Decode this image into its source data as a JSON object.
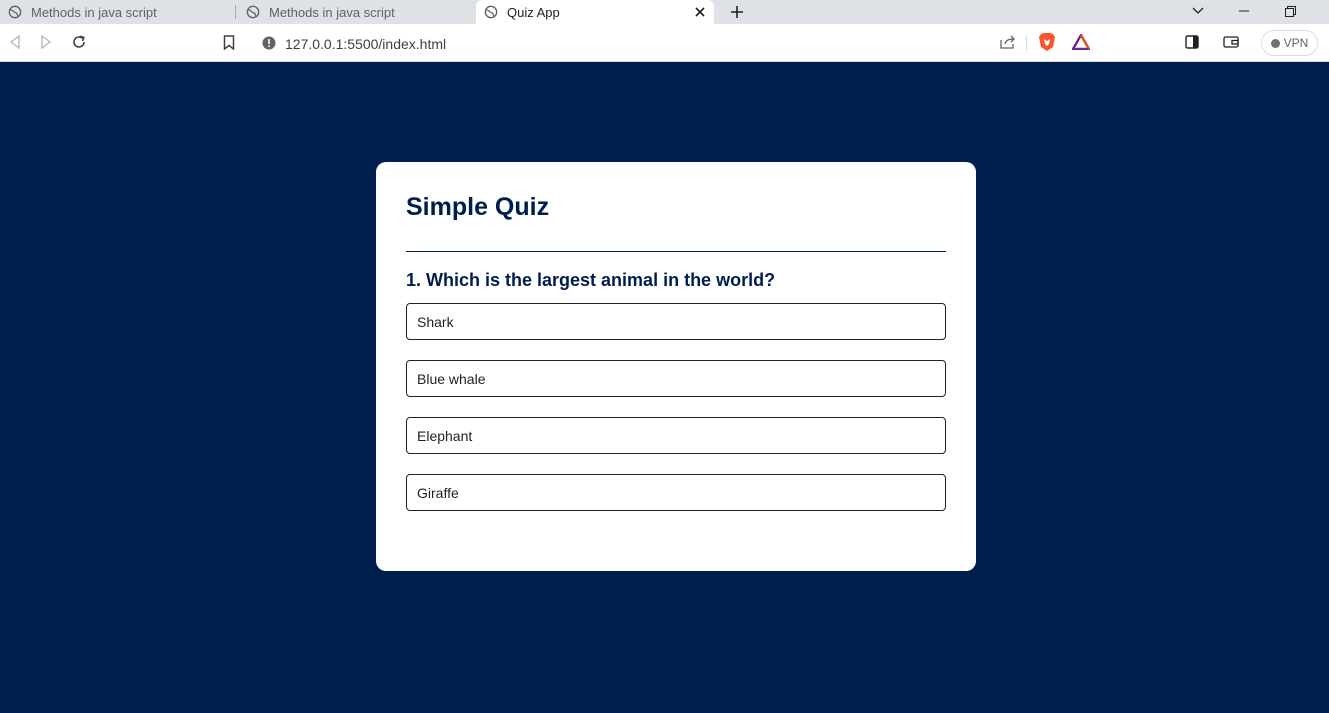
{
  "browser": {
    "tabs": [
      {
        "title": "Methods in java script",
        "icon": "globe-icon",
        "active": false
      },
      {
        "title": "Methods in java script",
        "icon": "globe-icon",
        "active": false
      },
      {
        "title": "Quiz App",
        "icon": "globe-icon",
        "active": true
      }
    ],
    "url": "127.0.0.1:5500/index.html",
    "vpn_label": "VPN"
  },
  "quiz": {
    "title": "Simple Quiz",
    "question": "1. Which is the largest animal in the world?",
    "answers": [
      "Shark",
      "Blue whale",
      "Elephant",
      "Giraffe"
    ]
  },
  "colors": {
    "page_background": "#001e4d",
    "card_background": "#ffffff",
    "heading": "#001e4d"
  }
}
